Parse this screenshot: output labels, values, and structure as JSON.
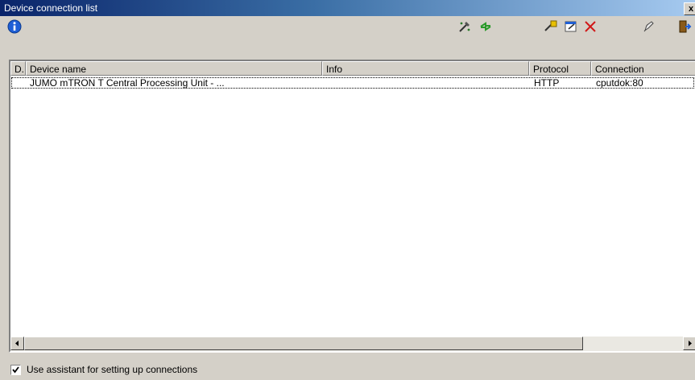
{
  "window": {
    "title": "Device connection list",
    "close_glyph": "x"
  },
  "toolbar": {
    "buttons": [
      {
        "name": "info-icon"
      },
      {
        "name": "scan-devices-icon"
      },
      {
        "name": "refresh-icon"
      },
      {
        "name": "add-device-icon"
      },
      {
        "name": "properties-icon"
      },
      {
        "name": "delete-icon"
      },
      {
        "name": "connect-icon"
      },
      {
        "name": "exit-icon"
      }
    ]
  },
  "list": {
    "columns": [
      "D.",
      "Device name",
      "Info",
      "Protocol",
      "Connection"
    ],
    "rows": [
      {
        "d": "",
        "device_name": "JUMO mTRON T Central Processing Unit - ...",
        "info": "",
        "protocol": "HTTP",
        "connection": "cputdok:80"
      }
    ]
  },
  "footer": {
    "assistant_label": "Use assistant for setting up connections",
    "assistant_checked": true
  },
  "colors": {
    "title_start": "#0a246a",
    "title_end": "#a6caf0",
    "face": "#d4d0c8"
  }
}
